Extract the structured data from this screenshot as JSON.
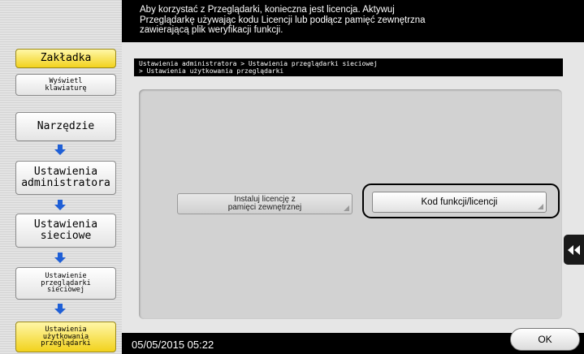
{
  "header": {
    "message": "Aby korzystać z Przeglądarki, konieczna jest licencja. Aktywuj\nPrzeglądarkę używając kodu Licencji lub podłącz pamięć zewnętrzna\nzawierającą plik weryfikacji funkcji."
  },
  "breadcrumb": "Ustawienia administratora > Ustawienia przeglądarki sieciowej\n> Ustawienia użytkowania przeglądarki",
  "sidebar": {
    "bookmark_label": "Zakładka",
    "keyboard_label": "Wyświetl\nklawiaturę",
    "steps": [
      "Narzędzie",
      "Ustawienia\nadministratora",
      "Ustawienia\nsieciowe",
      "Ustawienie\nprzeglądarki\nsieciowej",
      "Ustawienia\nużytkowania\nprzeglądarki"
    ]
  },
  "buttons": {
    "install_label": "Instaluj licencję z\npamięci zewnętrznej",
    "code_label": "Kod funkcji/licencji",
    "ok_label": "OK"
  },
  "status": {
    "datetime": "05/05/2015  05:22"
  },
  "icons": {
    "step_arrow": "arrow-down-icon",
    "side_tab": "double-chevron-left-icon"
  },
  "colors": {
    "accent_yellow": "#f2d21c",
    "arrow_blue": "#1f5fd6"
  }
}
